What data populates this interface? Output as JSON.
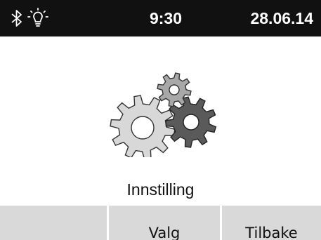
{
  "status_bar": {
    "icons": [
      "bluetooth-icon",
      "light-bulb-icon"
    ],
    "time": "9:30",
    "date": "28.06.14"
  },
  "main": {
    "icon": "gears-icon",
    "title": "Innstilling"
  },
  "softkeys": [
    {
      "label": ""
    },
    {
      "label": "Valg"
    },
    {
      "label": "Tilbake"
    }
  ],
  "colors": {
    "status_bar_bg": "#111111",
    "softkey_bg": "#d9d9d9",
    "gear_light": "#d8d8d8",
    "gear_mid": "#a8a8a8",
    "gear_dark": "#5a5a5a"
  }
}
